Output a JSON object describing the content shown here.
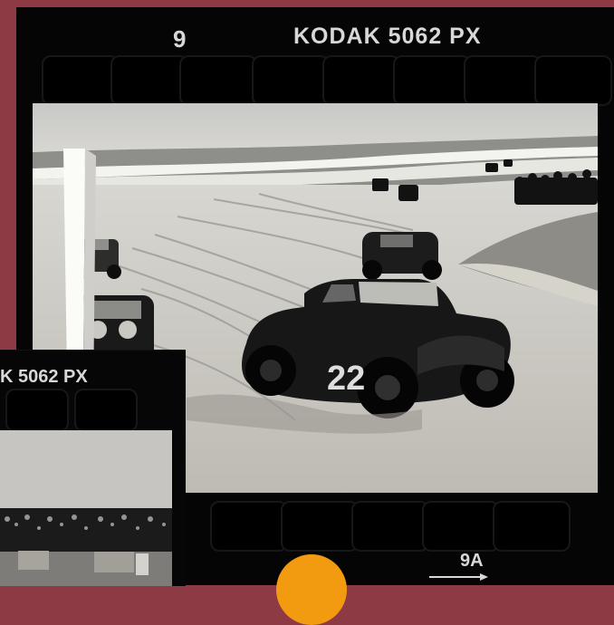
{
  "film": {
    "frame_number": "9",
    "brand_code": "KODAK  5062 PX",
    "second_frame_code": "K  5062 PX",
    "frame_sub_number": "9A"
  },
  "colors": {
    "background": "#8e3a44",
    "film": "#050505",
    "accent": "#f39b10"
  },
  "photo": {
    "car_number": "22"
  },
  "icons": {
    "frame_arrow": "arrow-right-icon",
    "orange_marker": "circle-icon"
  }
}
